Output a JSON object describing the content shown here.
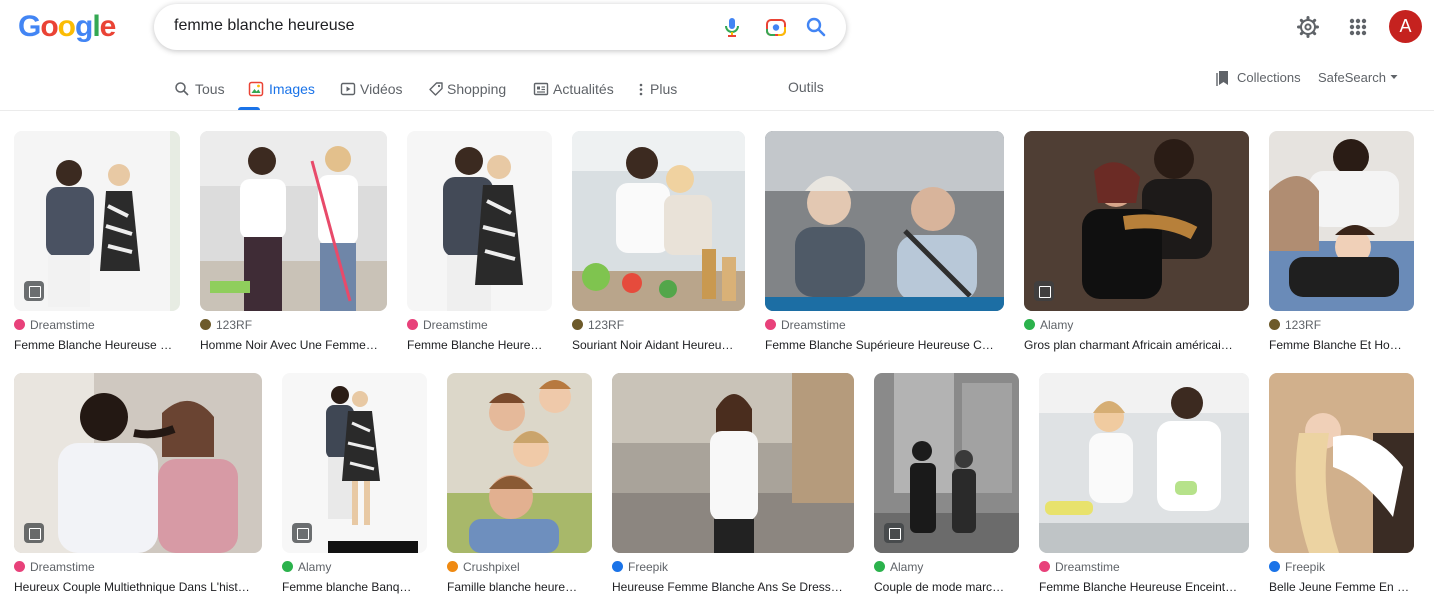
{
  "logo": {
    "letters": [
      "G",
      "o",
      "o",
      "g",
      "l",
      "e"
    ]
  },
  "search": {
    "query": "femme blanche heureuse"
  },
  "icons": {
    "mic": "mic-icon",
    "lens": "camera-lens-icon",
    "search": "search-icon",
    "settings": "gear-icon",
    "apps": "apps-grid-icon"
  },
  "account": {
    "initial": "A",
    "color": "#c5221f"
  },
  "tabs": [
    {
      "label": "Tous"
    },
    {
      "label": "Images"
    },
    {
      "label": "Vidéos"
    },
    {
      "label": "Shopping"
    },
    {
      "label": "Actualités"
    },
    {
      "label": "Plus"
    }
  ],
  "tools_label": "Outils",
  "collections_label": "Collections",
  "safesearch_label": "SafeSearch",
  "accent_color": "#1a73e8",
  "results": [
    {
      "source": "Dreamstime",
      "title": "Femme Blanche Heureuse …"
    },
    {
      "source": "123RF",
      "title": "Homme Noir Avec Une Femme…"
    },
    {
      "source": "Dreamstime",
      "title": "Femme Blanche Heure…"
    },
    {
      "source": "123RF",
      "title": "Souriant Noir Aidant Heureu…"
    },
    {
      "source": "Dreamstime",
      "title": "Femme Blanche Supérieure Heureuse C…"
    },
    {
      "source": "Alamy",
      "title": "Gros plan charmant Africain américai…"
    },
    {
      "source": "123RF",
      "title": "Femme Blanche Et Ho…"
    },
    {
      "source": "Dreamstime",
      "title": "Heureux Couple Multiethnique Dans L'hist…"
    },
    {
      "source": "Alamy",
      "title": "Femme blanche Banqu…"
    },
    {
      "source": "Crushpixel",
      "title": "Famille blanche heureu…"
    },
    {
      "source": "Freepik",
      "title": "Heureuse Femme Blanche Ans Se Dress…"
    },
    {
      "source": "Alamy",
      "title": "Couple de mode march…"
    },
    {
      "source": "Dreamstime",
      "title": "Femme Blanche Heureuse Enceint…"
    },
    {
      "source": "Freepik",
      "title": "Belle Jeune Femme En …"
    }
  ]
}
